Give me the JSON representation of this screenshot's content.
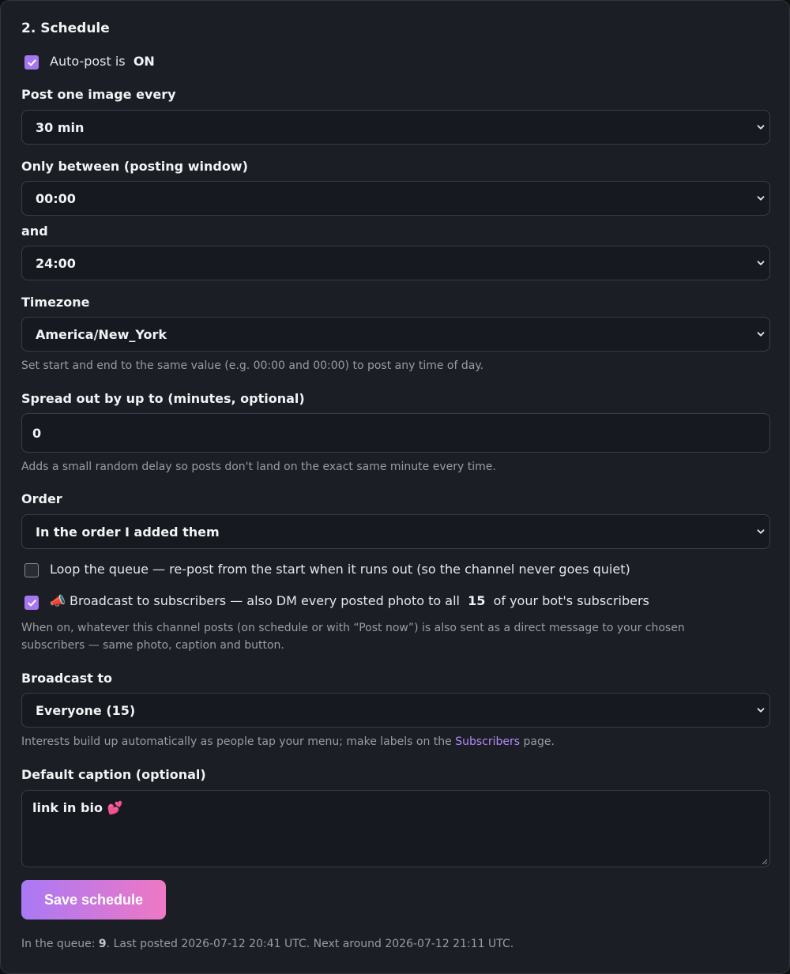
{
  "section_title": "2. Schedule",
  "autopost": {
    "checked": true,
    "label": "Auto-post is",
    "state": "ON"
  },
  "interval": {
    "label": "Post one image every",
    "value": "30 min"
  },
  "window": {
    "label": "Only between (posting window)",
    "start": "00:00",
    "and_label": "and",
    "end": "24:00"
  },
  "timezone": {
    "label": "Timezone",
    "value": "America/New_York",
    "help": "Set start and end to the same value (e.g. 00:00 and 00:00) to post any time of day."
  },
  "spread": {
    "label": "Spread out by up to (minutes, optional)",
    "value": "0",
    "help": "Adds a small random delay so posts don't land on the exact same minute every time."
  },
  "order": {
    "label": "Order",
    "value": "In the order I added them"
  },
  "loop": {
    "checked": false,
    "label": "Loop the queue — re-post from the start when it runs out (so the channel never goes quiet)"
  },
  "broadcast": {
    "checked": true,
    "icon": "megaphone-icon",
    "label_before": "📣 Broadcast to subscribers — also DM every posted photo to all",
    "count": "15",
    "label_after": "of your bot's subscribers",
    "help_line1": "When on, whatever this channel posts (on schedule or with “Post now”) is also sent as a direct message to your chosen",
    "help_line2": "subscribers — same photo, caption and button."
  },
  "broadcast_to": {
    "label": "Broadcast to",
    "value": "Everyone (15)",
    "help_before": "Interests build up automatically as people tap your menu; make labels on the",
    "help_link": "Subscribers",
    "help_after": "page."
  },
  "caption": {
    "label": "Default caption (optional)",
    "value": "link in bio 💕"
  },
  "save_label": "Save schedule",
  "footer": {
    "queue_label": "In the queue:",
    "queue_count": "9",
    "rest": ". Last posted 2026-07-12 20:41 UTC. Next around 2026-07-12 21:11 UTC."
  },
  "colors": {
    "accent": "#a675f0",
    "gradient_start": "#a979f5",
    "gradient_end": "#ef78c4",
    "link": "#b08cf6"
  }
}
